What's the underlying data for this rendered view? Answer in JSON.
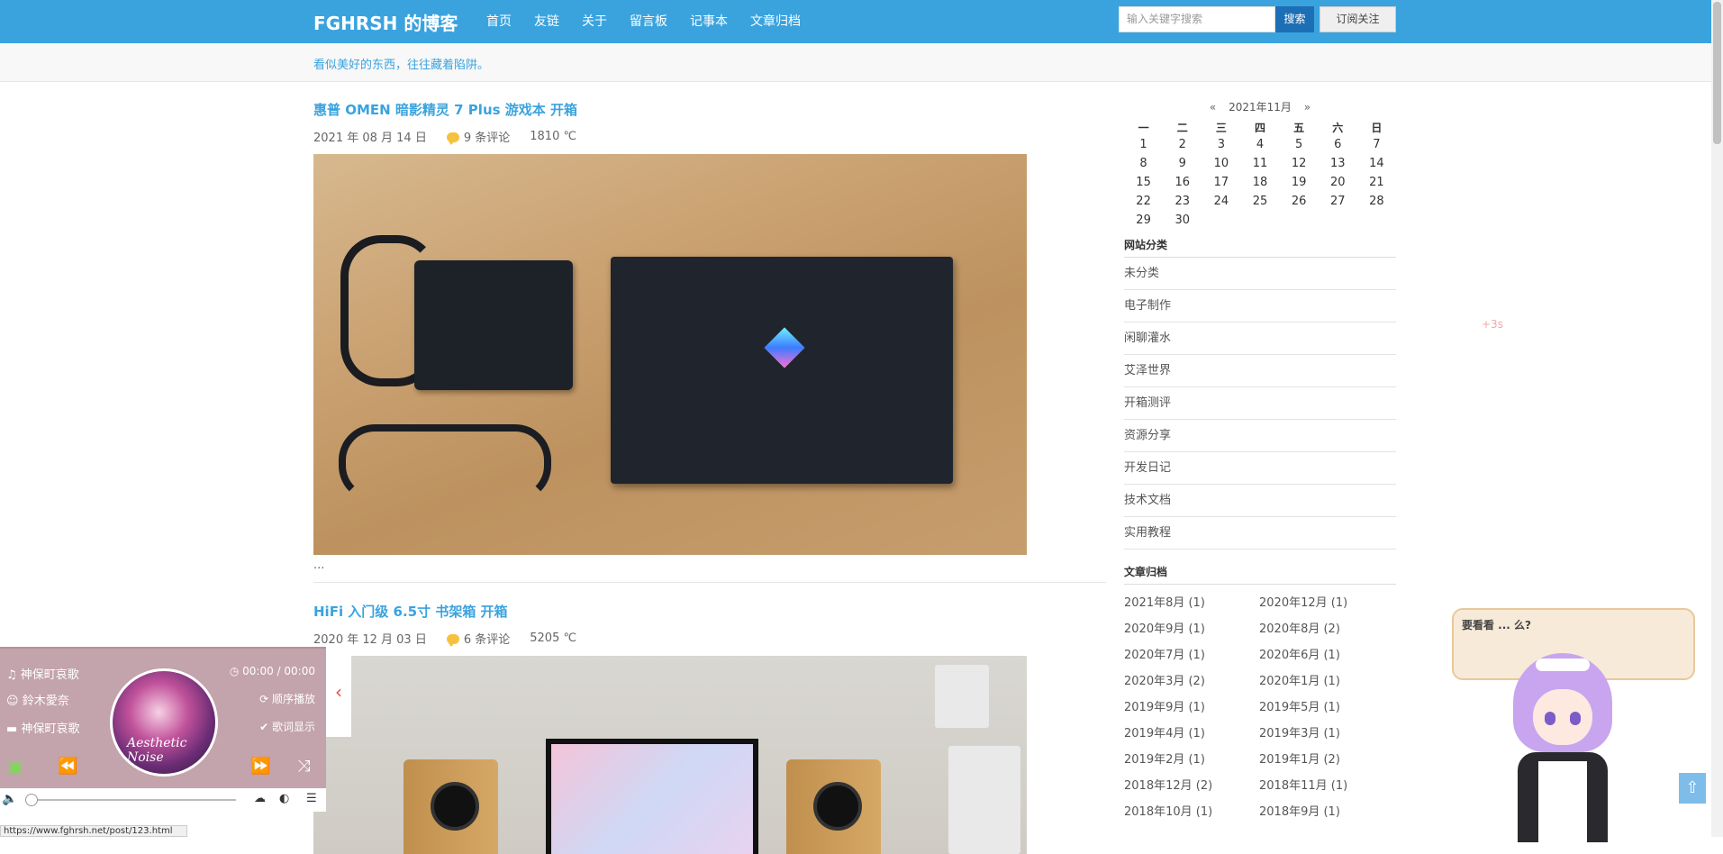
{
  "header": {
    "site_title": "FGHRSH 的博客",
    "nav": [
      "首页",
      "友链",
      "关于",
      "留言板",
      "记事本",
      "文章归档"
    ],
    "search_placeholder": "输入关键字搜索",
    "search_button": "搜索",
    "subscribe_button": "订阅关注"
  },
  "tagline": "看似美好的东西，往往藏着陷阱。",
  "posts": [
    {
      "title": "惠普 OMEN 暗影精灵 7 Plus 游戏本 开箱",
      "date": "2021 年 08 月 14 日",
      "comments": "9 条评论",
      "heat": "1810 ℃",
      "excerpt": "..."
    },
    {
      "title": "HiFi 入门级 6.5寸 书架箱 开箱",
      "date": "2020 年 12 月 03 日",
      "comments": "6 条评论",
      "heat": "5205 ℃"
    }
  ],
  "calendar": {
    "prev": "«",
    "month": "2021年11月",
    "next": "»",
    "weekdays": [
      "一",
      "二",
      "三",
      "四",
      "五",
      "六",
      "日"
    ],
    "weeks": [
      [
        "1",
        "2",
        "3",
        "4",
        "5",
        "6",
        "7"
      ],
      [
        "8",
        "9",
        "10",
        "11",
        "12",
        "13",
        "14"
      ],
      [
        "15",
        "16",
        "17",
        "18",
        "19",
        "20",
        "21"
      ],
      [
        "22",
        "23",
        "24",
        "25",
        "26",
        "27",
        "28"
      ],
      [
        "29",
        "30",
        "",
        "",
        "",
        "",
        ""
      ]
    ]
  },
  "categories": {
    "title": "网站分类",
    "items": [
      "未分类",
      "电子制作",
      "闲聊灌水",
      "艾泽世界",
      "开箱测评",
      "资源分享",
      "开发日记",
      "技术文档",
      "实用教程"
    ]
  },
  "archives": {
    "title": "文章归档",
    "items": [
      "2021年8月 (1)",
      "2020年12月 (1)",
      "2020年9月 (1)",
      "2020年8月 (2)",
      "2020年7月 (1)",
      "2020年6月 (1)",
      "2020年3月 (2)",
      "2020年1月 (1)",
      "2019年9月 (1)",
      "2019年5月 (1)",
      "2019年4月 (1)",
      "2019年3月 (1)",
      "2019年2月 (1)",
      "2019年1月 (2)",
      "2018年12月 (2)",
      "2018年11月 (1)",
      "2018年10月 (1)",
      "2018年9月 (1)"
    ]
  },
  "widget": {
    "timer": "+3s",
    "bubble_text": "要看看 ... 么?"
  },
  "player": {
    "song": "神保町哀歌",
    "artist": "鈴木愛奈",
    "album": "神保町哀歌",
    "time": "00:00 / 00:00",
    "order_mode": "顺序播放",
    "lyrics_toggle": "歌词显示",
    "cover_text": "Aesthetic Noise"
  },
  "status_url": "https://www.fghrsh.net/post/123.html"
}
